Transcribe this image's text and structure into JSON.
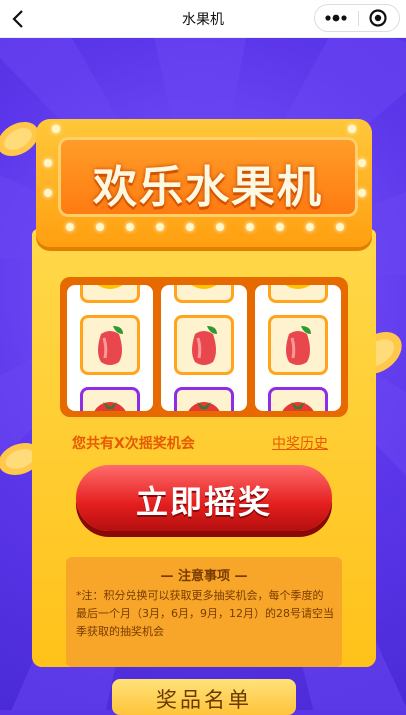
{
  "navbar": {
    "title": "水果机",
    "back_icon": "chevron-left-icon",
    "more_icon": "more-dots-icon",
    "close_icon": "close-circle-icon"
  },
  "machine": {
    "sign_title": "欢乐水果机",
    "reels": [
      [
        "banana",
        "wax-apple",
        "tomato"
      ],
      [
        "banana",
        "wax-apple",
        "tomato"
      ],
      [
        "banana",
        "wax-apple",
        "tomato"
      ]
    ],
    "draw_count_text": "您共有X次摇奖机会",
    "history_link": "中奖历史",
    "draw_button": "立即摇奖"
  },
  "notice": {
    "title": "— 注意事项 —",
    "body": "*注：积分兑换可以获取更多抽奖机会，每个季度的最后一个月（3月，6月，9月，12月）的28号请空当季获取的抽奖机会"
  },
  "prize_list": {
    "title": "奖品名单"
  },
  "colors": {
    "background": "#5b34e8",
    "machine_yellow": "#ffc21a",
    "button_red": "#e41e1e",
    "text_orange": "#e65a00"
  }
}
